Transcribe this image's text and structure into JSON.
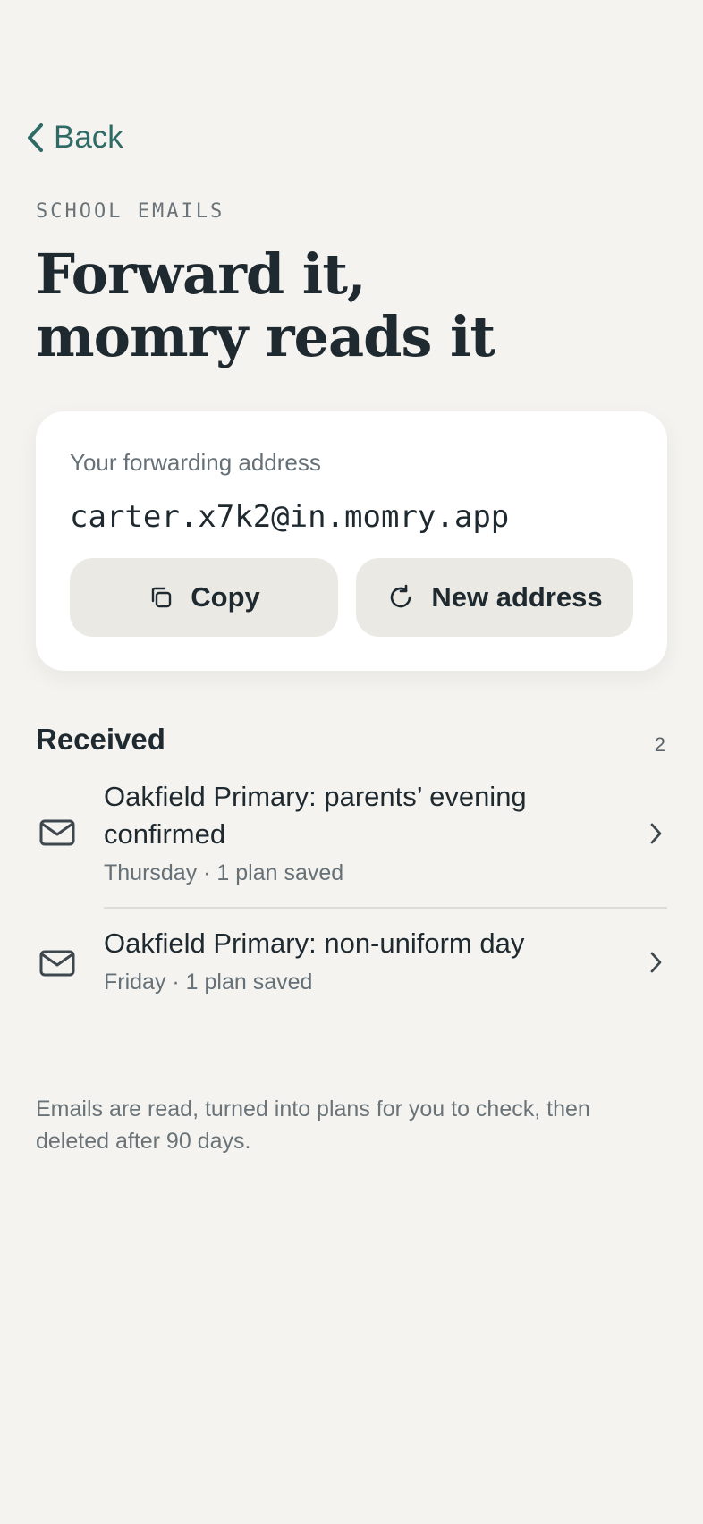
{
  "nav": {
    "back_label": "Back"
  },
  "header": {
    "eyebrow": "SCHOOL EMAILS",
    "title_line1": "Forward it,",
    "title_line2": "momry reads it"
  },
  "forwarding_card": {
    "label": "Your forwarding address",
    "address": "carter.x7k2@in.momry.app",
    "copy_label": "Copy",
    "new_address_label": "New address"
  },
  "received": {
    "title": "Received",
    "count": "2",
    "items": [
      {
        "subject": "Oakfield Primary: parents’ evening confirmed",
        "meta": "Thursday · 1 plan saved",
        "icon": "mail-icon"
      },
      {
        "subject": "Oakfield Primary: non-uniform day",
        "meta": "Friday · 1 plan saved",
        "icon": "mail-icon"
      }
    ]
  },
  "footnote": "Emails are read, turned into plans for you to check, then deleted after 90 days.",
  "colors": {
    "background": "#f4f3ef",
    "accent": "#2f6b66",
    "card": "#ffffff",
    "button": "#ebe9e3",
    "text": "#1f2a30",
    "muted": "#667077"
  }
}
